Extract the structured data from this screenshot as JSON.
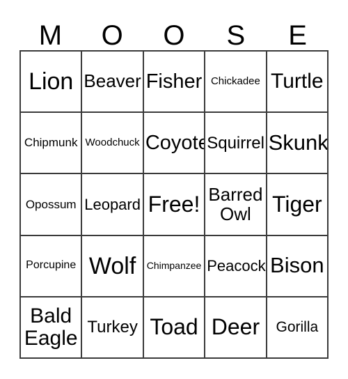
{
  "card": {
    "header_letters": [
      "M",
      "O",
      "O",
      "S",
      "E"
    ],
    "free_space_label": "Free!",
    "columns": 5,
    "rows": 5,
    "border_color": "#3a3a3a",
    "text_color": "#000000",
    "background_color": "#ffffff",
    "rows_data": [
      {
        "cells": [
          {
            "label": "Lion",
            "size": "fs-34"
          },
          {
            "label": "Beaver",
            "size": "fs-26"
          },
          {
            "label": "Fisher",
            "size": "fs-29"
          },
          {
            "label": "Chickadee",
            "size": "fs-15"
          },
          {
            "label": "Turtle",
            "size": "fs-30"
          }
        ]
      },
      {
        "cells": [
          {
            "label": "Chipmunk",
            "size": "fs-17"
          },
          {
            "label": "Woodchuck",
            "size": "fs-15"
          },
          {
            "label": "Coyote",
            "size": "fs-29"
          },
          {
            "label": "Squirrel",
            "size": "fs-24"
          },
          {
            "label": "Skunk",
            "size": "fs-31"
          }
        ]
      },
      {
        "cells": [
          {
            "label": "Opossum",
            "size": "fs-17"
          },
          {
            "label": "Leopard",
            "size": "fs-22"
          },
          {
            "label": "Free!",
            "size": "fs-32"
          },
          {
            "label": "Barred\nOwl",
            "size": "fs-26"
          },
          {
            "label": "Tiger",
            "size": "fs-32"
          }
        ]
      },
      {
        "cells": [
          {
            "label": "Porcupine",
            "size": "fs-16"
          },
          {
            "label": "Wolf",
            "size": "fs-34"
          },
          {
            "label": "Chimpanzee",
            "size": "fs-14"
          },
          {
            "label": "Peacock",
            "size": "fs-22"
          },
          {
            "label": "Bison",
            "size": "fs-31"
          }
        ]
      },
      {
        "cells": [
          {
            "label": "Bald\nEagle",
            "size": "fs-30"
          },
          {
            "label": "Turkey",
            "size": "fs-24"
          },
          {
            "label": "Toad",
            "size": "fs-32"
          },
          {
            "label": "Deer",
            "size": "fs-32"
          },
          {
            "label": "Gorilla",
            "size": "fs-21"
          }
        ]
      }
    ]
  }
}
